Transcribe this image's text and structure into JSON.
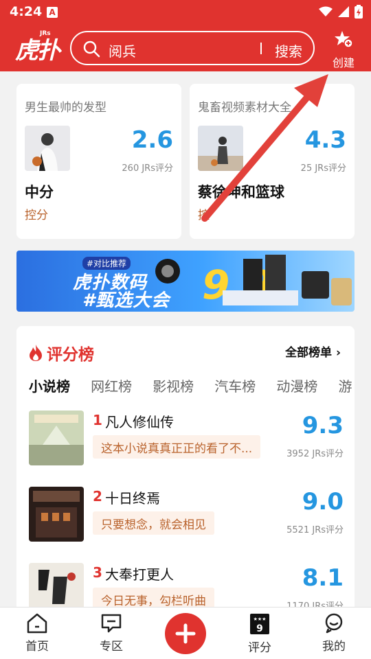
{
  "status": {
    "time": "4:24",
    "notification_glyph": "A"
  },
  "header": {
    "logo_text": "虎扑",
    "logo_badge": "JRs",
    "search_placeholder": "阅兵",
    "search_button": "搜索",
    "create_label": "创建",
    "brand_color": "#e0332f"
  },
  "cards": [
    {
      "tag": "男生最帅的发型",
      "score": "2.6",
      "count": "260 JRs评分",
      "name": "中分",
      "sub": "控分"
    },
    {
      "tag": "鬼畜视频素材大全",
      "score": "4.3",
      "count": "25 JRs评分",
      "name": "蔡徐坤和篮球",
      "sub": "控"
    }
  ],
  "banner": {
    "tag": "#对比推荐",
    "line1": "虎扑数码",
    "line2": "#甄选大会"
  },
  "ranking": {
    "title": "评分榜",
    "all_label": "全部榜单 ›",
    "tabs": [
      "小说榜",
      "网红榜",
      "影视榜",
      "汽车榜",
      "动漫榜",
      "游"
    ],
    "items": [
      {
        "rank": "1",
        "title": "凡人修仙传",
        "quote": "这本小说真真正正的看了不...",
        "score": "9.3",
        "count": "3952 JRs评分"
      },
      {
        "rank": "2",
        "title": "十日终焉",
        "quote": "只要想念，就会相见",
        "score": "9.0",
        "count": "5521 JRs评分"
      },
      {
        "rank": "3",
        "title": "大奉打更人",
        "quote": "今日无事，勾栏听曲",
        "score": "8.1",
        "count": "1170 JRs评分"
      }
    ]
  },
  "bottom_nav": {
    "home": "首页",
    "zone": "专区",
    "rating": "评分",
    "mine": "我的"
  },
  "colors": {
    "accent": "#e0332f",
    "score_blue": "#2596e0",
    "quote_text": "#b9622c"
  }
}
